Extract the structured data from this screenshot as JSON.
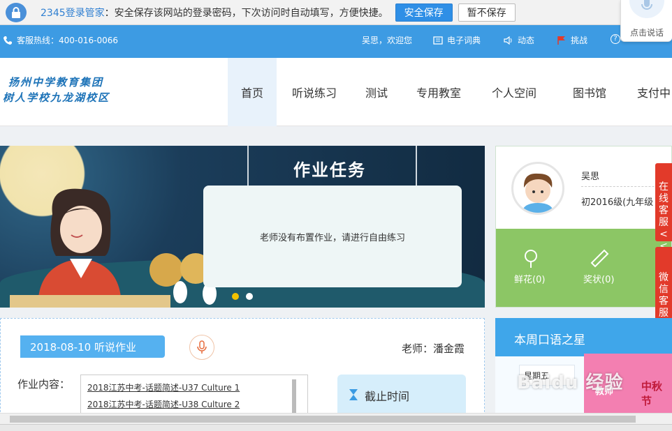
{
  "password_bar": {
    "brand": "2345登录管家",
    "message": "：安全保存该网站的登录密码，下次访问时自动填写，方便快捷。",
    "save_button": "安全保存",
    "nosave_button": "暂不保存"
  },
  "voice": {
    "label": "点击说话"
  },
  "topbar": {
    "hotline": "客服热线：400-016-0066",
    "welcome": "吴思，欢迎您",
    "dictionary": "电子词典",
    "news": "动态",
    "challenge": "挑战",
    "help": "?"
  },
  "header": {
    "logo_line1": "扬州中学教育集团",
    "logo_line2": "树人学校九龙湖校区",
    "nav": [
      {
        "label": "首页"
      },
      {
        "label": "听说练习"
      },
      {
        "label": "测试"
      },
      {
        "label": "专用教室"
      },
      {
        "label": "个人空间"
      },
      {
        "label": "图书馆"
      },
      {
        "label": "支付中"
      }
    ]
  },
  "banner": {
    "title": "作业任务",
    "message": "老师没有布置作业，请进行自由练习"
  },
  "profile": {
    "name": "吴思",
    "grade": "初2016级(九年级",
    "flowers": "鲜花(0)",
    "awards": "奖状(0)"
  },
  "side_tabs": {
    "online": "在线客服<<",
    "wechat": "微信客服"
  },
  "homework": {
    "date_title": "2018-08-10  听说作业",
    "teacher": "老师：潘金霞",
    "content_label": "作业内容：",
    "items": [
      "2018江苏中考-话题简述-U37 Culture 1",
      "2018江苏中考-话题简述-U38 Culture 2"
    ],
    "deadline_label": "截止时间"
  },
  "oral_star": {
    "title": "本周口语之星",
    "day": "星期五",
    "promo_text1": "教师",
    "promo_text2": "中秋节"
  },
  "watermark": "Baidu 经验",
  "colors": {
    "brand_blue": "#3d9be3",
    "accent_red": "#e23a2a",
    "green": "#8cc665"
  }
}
